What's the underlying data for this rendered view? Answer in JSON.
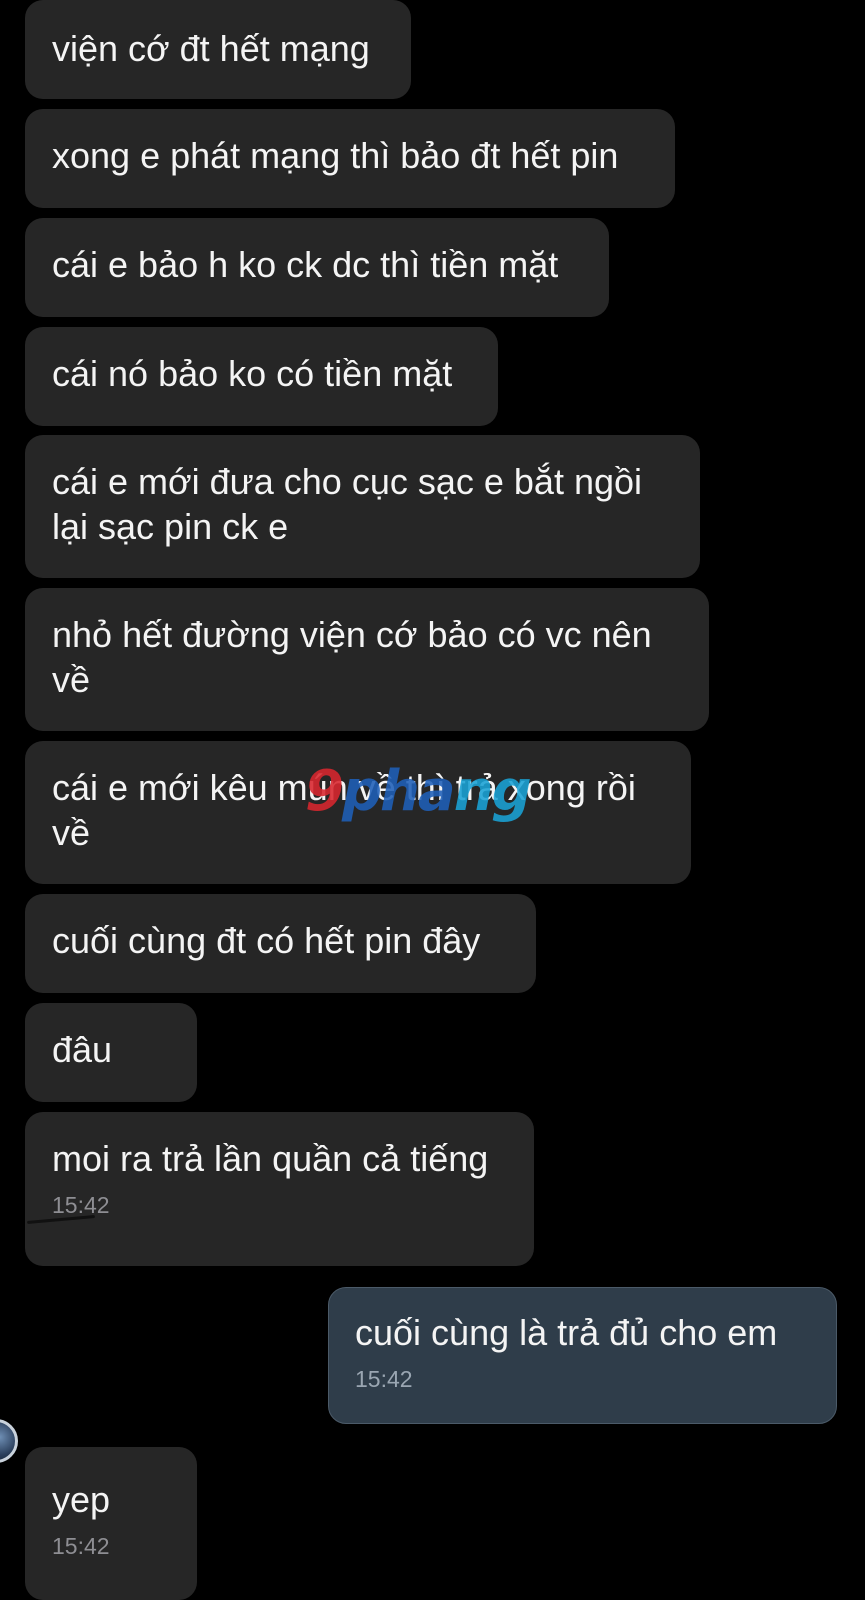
{
  "messages": [
    {
      "text": "viện cớ đt hết mạng"
    },
    {
      "text": "xong e phát mạng thì bảo đt hết pin"
    },
    {
      "text": "cái e bảo h ko ck dc thì tiền mặt"
    },
    {
      "text": "cái nó bảo ko có tiền mặt"
    },
    {
      "text": "cái e mới đưa cho cục sạc e bắt ngồi lại sạc pin ck e"
    },
    {
      "text": "nhỏ hết đường viện cớ bảo có vc nên về"
    },
    {
      "text": "cái e mới kêu mún về thì trả xong rồi về"
    },
    {
      "text": "cuối cùng đt có hết pin đây"
    },
    {
      "text": "đâu"
    },
    {
      "text": "moi ra trả lần quần cả tiếng",
      "time": "15:42"
    },
    {
      "text": "cuối cùng là trả đủ cho em",
      "time": "15:42"
    },
    {
      "text": "yep",
      "time": "15:42"
    }
  ],
  "watermark": {
    "part1": "9",
    "part2": "pha",
    "part3": "ng"
  },
  "colors": {
    "background": "#000000",
    "incoming_bubble": "#262626",
    "outgoing_bubble": "#2f3d4a",
    "timestamp": "#8e8e93"
  },
  "icons": {
    "avatar": "contact-avatar"
  }
}
